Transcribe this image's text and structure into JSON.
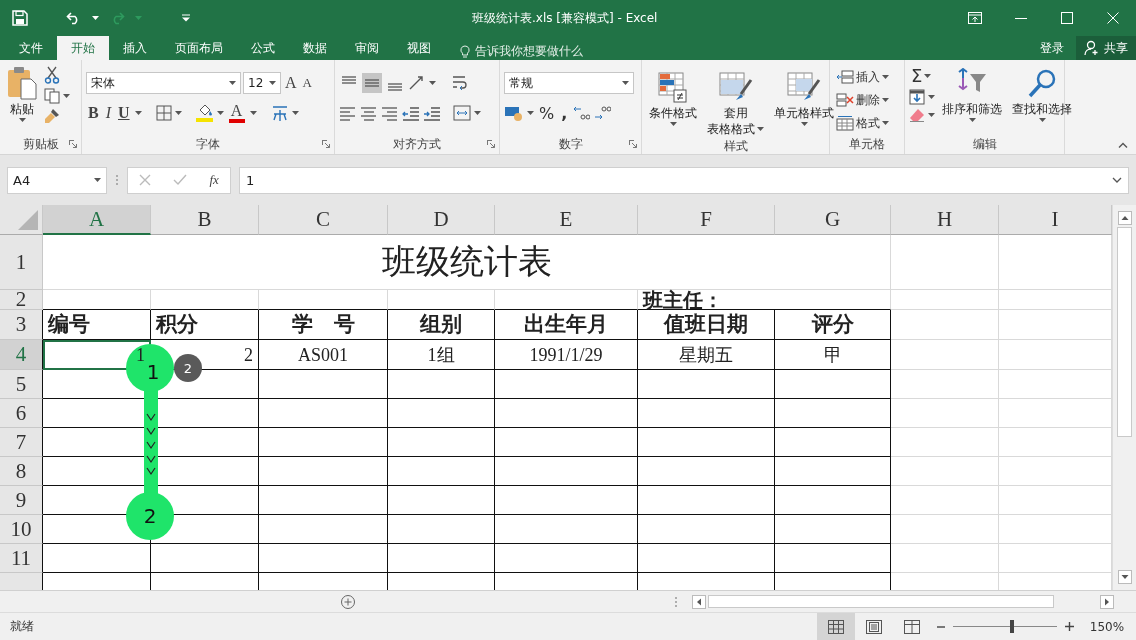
{
  "title_bar": {
    "title": "班级统计表.xls  [兼容模式] - Excel"
  },
  "menu_tabs": [
    {
      "label": "文件",
      "selected": false
    },
    {
      "label": "开始",
      "selected": true
    },
    {
      "label": "插入",
      "selected": false
    },
    {
      "label": "页面布局",
      "selected": false
    },
    {
      "label": "公式",
      "selected": false
    },
    {
      "label": "数据",
      "selected": false
    },
    {
      "label": "审阅",
      "selected": false
    },
    {
      "label": "视图",
      "selected": false
    }
  ],
  "tell_me": {
    "placeholder": "告诉我你想要做什么"
  },
  "account": {
    "login": "登录",
    "share": "共享"
  },
  "ribbon": {
    "clipboard": {
      "paste": "粘贴",
      "label": "剪贴板"
    },
    "font": {
      "font_name": "宋体",
      "font_size": "12",
      "grow": "A",
      "shrink": "A",
      "bold": "B",
      "italic": "I",
      "underline": "U",
      "font_color": "A",
      "label": "字体"
    },
    "alignment": {
      "vertical": [
        {
          "kind": "top",
          "selected": false
        },
        {
          "kind": "middle",
          "selected": true
        },
        {
          "kind": "bottom",
          "selected": false
        }
      ],
      "label": "对齐方式"
    },
    "number": {
      "format": "常规",
      "percent": "%",
      "comma": ",",
      "label": "数字"
    },
    "styles": {
      "conditional": "条件格式",
      "table_format": [
        "套用",
        "表格格式"
      ],
      "cell_styles": "单元格样式",
      "label": "样式"
    },
    "cells": {
      "insert": "插入",
      "delete": "删除",
      "format": "格式",
      "label": "单元格"
    },
    "editing": {
      "autosum": "Σ",
      "sort_filter": "排序和筛选",
      "find_select": "查找和选择",
      "label": "编辑"
    }
  },
  "formula_bar": {
    "name_box": "A4",
    "fx": "fx",
    "value": "1"
  },
  "columns": [
    {
      "label": "A",
      "selected": true
    },
    {
      "label": "B",
      "selected": false
    },
    {
      "label": "C",
      "selected": false
    },
    {
      "label": "D",
      "selected": false
    },
    {
      "label": "E",
      "selected": false
    },
    {
      "label": "F",
      "selected": false
    },
    {
      "label": "G",
      "selected": false
    },
    {
      "label": "H",
      "selected": false
    },
    {
      "label": "I",
      "selected": false
    }
  ],
  "rows": [
    {
      "header": "1",
      "kind": "title",
      "selected": false,
      "cells": [
        "班级统计表"
      ]
    },
    {
      "header": "2",
      "kind": "note",
      "selected": false,
      "cells": [
        "班主任："
      ]
    },
    {
      "header": "3",
      "kind": "header",
      "selected": false,
      "cells": [
        "编号",
        "积分",
        "学　号",
        "组别",
        "出生年月",
        "值班日期",
        "评分"
      ]
    },
    {
      "header": "4",
      "kind": "data",
      "selected": true,
      "cells": [
        "1",
        "2",
        "AS001",
        "1组",
        "1991/1/29",
        "星期五",
        "甲"
      ]
    },
    {
      "header": "5",
      "kind": "grid",
      "selected": false
    },
    {
      "header": "6",
      "kind": "grid",
      "selected": false
    },
    {
      "header": "7",
      "kind": "grid",
      "selected": false
    },
    {
      "header": "8",
      "kind": "grid",
      "selected": false
    },
    {
      "header": "9",
      "kind": "grid",
      "selected": false
    },
    {
      "header": "10",
      "kind": "grid",
      "selected": false
    },
    {
      "header": "11",
      "kind": "grid",
      "selected": false
    },
    {
      "kind": "grid",
      "selected": false
    }
  ],
  "overlay": {
    "start": "1",
    "end": "2",
    "badge": "2"
  },
  "status_bar": {
    "status": "就绪",
    "views": [
      {
        "kind": "normal",
        "selected": true
      },
      {
        "kind": "page_layout",
        "selected": false
      },
      {
        "kind": "page_break",
        "selected": false
      }
    ],
    "zoom": {
      "level": 0.57,
      "reading": "150%"
    }
  }
}
